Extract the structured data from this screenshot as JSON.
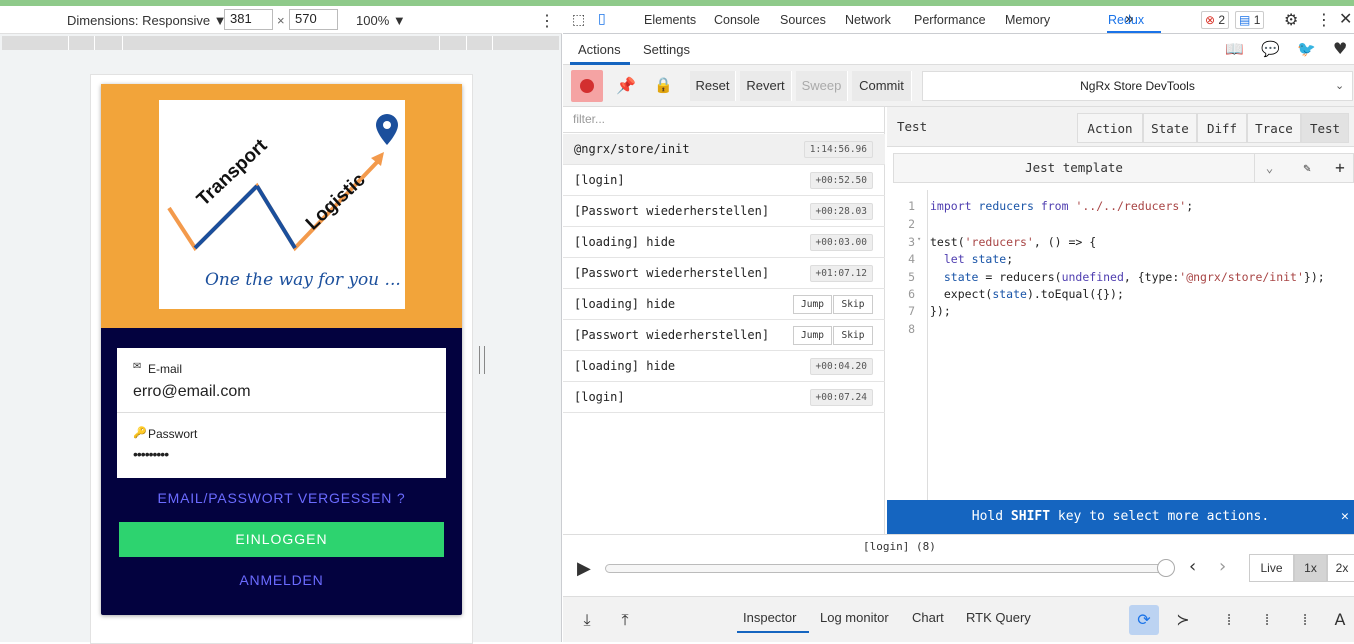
{
  "device_toolbar": {
    "dimensions_label": "Dimensions: Responsive ▼",
    "width": "381",
    "times": "×",
    "height": "570",
    "zoom": "100% ▼",
    "more": "⋮"
  },
  "app": {
    "logo_text_transport": "Transport",
    "logo_text_logistic": "Logistic",
    "logo_tagline": "One the way for you ...",
    "email_label": "E-mail",
    "email_value": "erro@email.com",
    "password_label": "Passwort",
    "password_value": "•••••••••",
    "forgot_link": "EMAIL/PASSWORT VERGESSEN ?",
    "login_button": "EINLOGGEN",
    "register_link": "ANMELDEN",
    "colors": {
      "hero": "#f2a43a",
      "card": "#03023f",
      "login": "#2dd36f",
      "link": "#6b6bff"
    }
  },
  "devtools": {
    "tabs": [
      "Elements",
      "Console",
      "Sources",
      "Network",
      "Performance",
      "Memory",
      "Redux"
    ],
    "more_tabs": "»",
    "error_count": "2",
    "message_count": "1",
    "sub_tabs": {
      "actions": "Actions",
      "settings": "Settings"
    },
    "toolbar": {
      "reset": "Reset",
      "revert": "Revert",
      "sweep": "Sweep",
      "commit": "Commit",
      "store": "NgRx Store DevTools"
    },
    "filter_placeholder": "filter...",
    "actions": [
      {
        "name": "@ngrx/store/init",
        "time": "1:14:56.96"
      },
      {
        "name": "[login]",
        "time": "+00:52.50"
      },
      {
        "name": "[Passwort wiederherstellen]",
        "time": "+00:28.03"
      },
      {
        "name": "[loading] hide",
        "time": "+00:03.00"
      },
      {
        "name": "[Passwort wiederherstellen]",
        "time": "+01:07.12"
      },
      {
        "name": "[loading] hide",
        "time": ""
      },
      {
        "name": "[Passwort wiederherstellen]",
        "time": ""
      },
      {
        "name": "[loading] hide",
        "time": "+00:04.20"
      },
      {
        "name": "[login]",
        "time": "+00:07.24"
      }
    ],
    "jump": "Jump",
    "skip": "Skip",
    "test_panel": {
      "title": "Test",
      "tabs": [
        "Action",
        "State",
        "Diff",
        "Trace",
        "Test"
      ],
      "template": "Jest template",
      "line_numbers": [
        "1",
        "2",
        "3",
        "4",
        "5",
        "6",
        "7",
        "8"
      ],
      "hint": "Hold SHIFT key to select more actions."
    },
    "slider": {
      "label": "[login] (8)",
      "live": "Live",
      "speed1": "1x",
      "speed2": "2x"
    },
    "bottom_tabs": [
      "Inspector",
      "Log monitor",
      "Chart",
      "RTK Query"
    ]
  }
}
